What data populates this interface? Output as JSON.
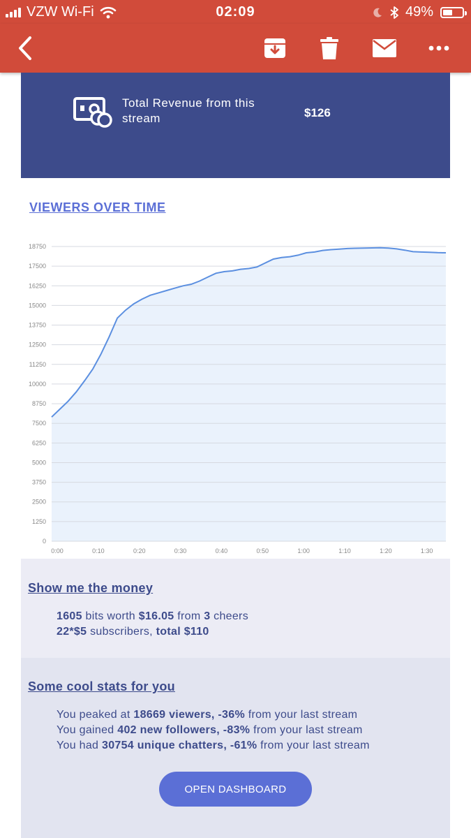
{
  "status_bar": {
    "carrier": "VZW Wi-Fi",
    "time": "02:09",
    "battery": "49%"
  },
  "toolbar": {
    "icons": [
      "back-icon",
      "archive-icon",
      "trash-icon",
      "mail-icon",
      "more-icon"
    ]
  },
  "revenue": {
    "label": "Total Revenue from this stream",
    "amount": "$126"
  },
  "viewers_title": "VIEWERS OVER TIME",
  "chart_data": {
    "type": "area",
    "x": [
      "0:00",
      "0:02",
      "0:04",
      "0:06",
      "0:08",
      "0:10",
      "0:12",
      "0:14",
      "0:16",
      "0:18",
      "0:20",
      "0:22",
      "0:24",
      "0:26",
      "0:28",
      "0:30",
      "0:32",
      "0:34",
      "0:36",
      "0:38",
      "0:40",
      "0:42",
      "0:44",
      "0:46",
      "0:48",
      "0:50",
      "0:52",
      "0:54",
      "0:56",
      "0:58",
      "1:00",
      "1:02",
      "1:04",
      "1:06",
      "1:08",
      "1:10",
      "1:12",
      "1:14",
      "1:16",
      "1:18",
      "1:20",
      "1:22",
      "1:24",
      "1:26",
      "1:28",
      "1:30",
      "1:32",
      "1:34",
      "1:36"
    ],
    "values": [
      7900,
      8400,
      8900,
      9500,
      10200,
      10950,
      11900,
      13000,
      14200,
      14700,
      15100,
      15400,
      15650,
      15800,
      15950,
      16100,
      16250,
      16350,
      16550,
      16800,
      17050,
      17150,
      17200,
      17300,
      17350,
      17450,
      17700,
      17950,
      18050,
      18100,
      18200,
      18350,
      18400,
      18500,
      18550,
      18580,
      18620,
      18640,
      18650,
      18660,
      18669,
      18650,
      18600,
      18520,
      18420,
      18400,
      18380,
      18360,
      18350
    ],
    "title": "VIEWERS OVER TIME",
    "xticks": [
      "0:00",
      "0:10",
      "0:20",
      "0:30",
      "0:40",
      "0:50",
      "1:00",
      "1:10",
      "1:20",
      "1:30"
    ],
    "yticks": [
      0,
      1250,
      2500,
      3750,
      5000,
      6250,
      7500,
      8750,
      10000,
      11250,
      12500,
      13750,
      15000,
      16250,
      17500,
      18750
    ],
    "ylim": [
      0,
      18750
    ],
    "grid": true,
    "colors": {
      "line": "#5b8fe0",
      "fill": "#e6f0fb"
    }
  },
  "money": {
    "title": "Show me the money",
    "line1": {
      "bits": "1605",
      "t1": " bits worth ",
      "worth": "$16.05",
      "t2": " from ",
      "cheers": "3",
      "t3": " cheers"
    },
    "line2": {
      "subs": "22*$5",
      "t1": " subscribers, ",
      "total": "total $110"
    }
  },
  "stats": {
    "title": "Some cool stats for you",
    "line1": {
      "t1": "You peaked at ",
      "b1": "18669 viewers, -36%",
      "t2": " from your last stream"
    },
    "line2": {
      "t1": "You gained ",
      "b1": "402 new followers, -83%",
      "t2": " from your last stream"
    },
    "line3": {
      "t1": "You had ",
      "b1": "30754 unique chatters, -61%",
      "t2": " from your last stream"
    },
    "button": "OPEN DASHBOARD"
  }
}
